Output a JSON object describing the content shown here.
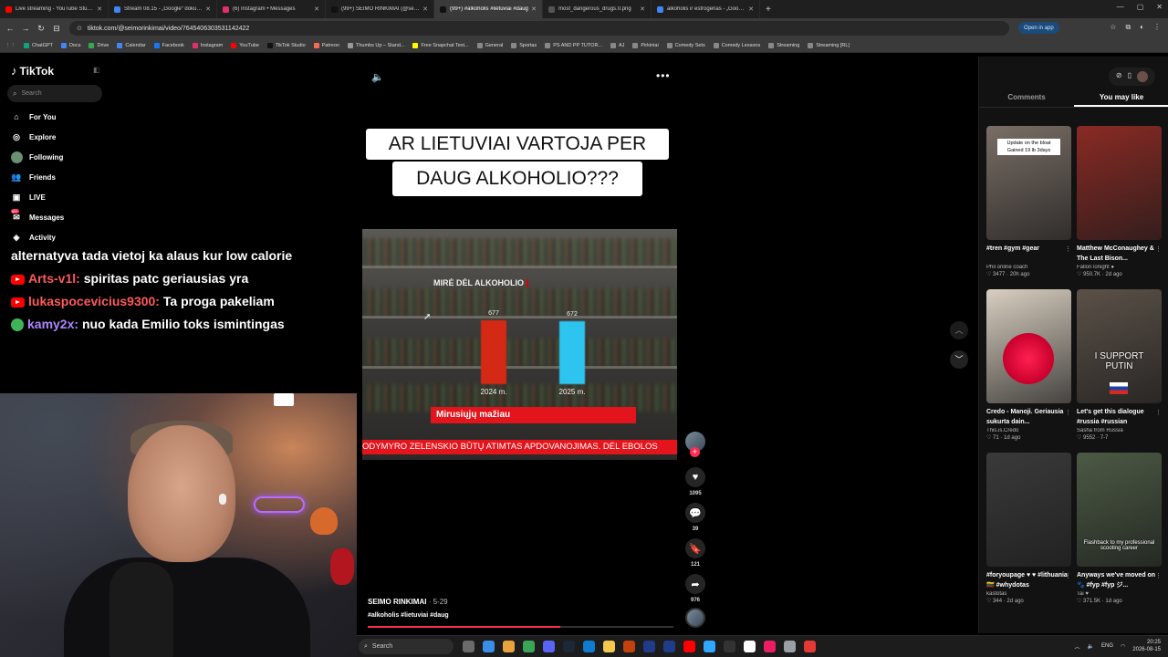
{
  "browser": {
    "tabs": [
      {
        "label": "Live streaming - YouTube Studio",
        "favicon_color": "#ff0000",
        "active": false
      },
      {
        "label": "Stream 08.15 - „Google“ dokumentai",
        "favicon_color": "#4285f4",
        "active": false
      },
      {
        "label": "(6) Instagram • Messages",
        "favicon_color": "#e1306c",
        "active": false
      },
      {
        "label": "(99+) SEIMO RINKIMAI (@seimorinkimai)",
        "favicon_color": "#111111",
        "active": false
      },
      {
        "label": "(99+) #alkoholis #lietuviai #daug",
        "favicon_color": "#111111",
        "active": true
      },
      {
        "label": "most_dangerous_drugs.0.png",
        "favicon_color": "#555555",
        "active": false
      },
      {
        "label": "alkoholis ir estrogenas - „Google“ paieška",
        "favicon_color": "#4285f4",
        "active": false
      }
    ],
    "url": "tiktok.com/@seimorinkimai/video/7645406303531142422",
    "open_app_label": "Open in app",
    "bookmarks": [
      {
        "label": "ChatGPT",
        "color": "#10a37f"
      },
      {
        "label": "Docs",
        "color": "#4285f4"
      },
      {
        "label": "Drive",
        "color": "#34a853"
      },
      {
        "label": "Calendar",
        "color": "#4285f4"
      },
      {
        "label": "Facebook",
        "color": "#1877f2"
      },
      {
        "label": "Instagram",
        "color": "#e1306c"
      },
      {
        "label": "YouTube",
        "color": "#ff0000"
      },
      {
        "label": "TikTok Studio",
        "color": "#111111"
      },
      {
        "label": "Patreon",
        "color": "#f96854"
      },
      {
        "label": "Thumbs Up – Stand...",
        "color": "#999999"
      },
      {
        "label": "Free Snapchat Text...",
        "color": "#fffc00"
      },
      {
        "label": "General",
        "color": "#888888"
      },
      {
        "label": "Sportas",
        "color": "#888888"
      },
      {
        "label": "PS AND PP TUTOR...",
        "color": "#888888"
      },
      {
        "label": "AJ",
        "color": "#888888"
      },
      {
        "label": "Pirkiniai",
        "color": "#888888"
      },
      {
        "label": "Comedy Sets",
        "color": "#888888"
      },
      {
        "label": "Comedy Lessons",
        "color": "#888888"
      },
      {
        "label": "Streaming",
        "color": "#888888"
      },
      {
        "label": "Streaming [RL]",
        "color": "#888888"
      }
    ]
  },
  "tiktok": {
    "logo": "TikTok",
    "search_placeholder": "Search",
    "nav": [
      {
        "label": "For You",
        "icon": "home-icon",
        "glyph": "⌂"
      },
      {
        "label": "Explore",
        "icon": "compass-icon",
        "glyph": "◎"
      },
      {
        "label": "Following",
        "icon": "following-avatar",
        "glyph": ""
      },
      {
        "label": "Friends",
        "icon": "friends-icon",
        "glyph": "👥"
      },
      {
        "label": "LIVE",
        "icon": "live-icon",
        "glyph": "▣"
      },
      {
        "label": "Messages",
        "icon": "messages-icon",
        "glyph": "✉"
      },
      {
        "label": "Activity",
        "icon": "activity-icon",
        "glyph": "◈"
      }
    ],
    "messages_badge": "99+"
  },
  "chat": [
    {
      "platform": "",
      "user": "",
      "text": "alternatyva tada vietoj ka alaus kur low calorie"
    },
    {
      "platform": "youtube",
      "user": "Arts-v1l:",
      "text": "spiritas patc geriausias yra"
    },
    {
      "platform": "youtube",
      "user": "lukaspocevicius9300:",
      "text": "Ta proga pakeliam"
    },
    {
      "platform": "twitch",
      "user": "kamy2x:",
      "text": "nuo kada Emilio toks ismintingas"
    }
  ],
  "video": {
    "caption_line1": "AR LIETUVIAI VARTOJA PER",
    "caption_line2": "DAUG ALKOHOLIO???",
    "author": "SEIMO RINKIMAI",
    "date": "· 5-29",
    "tags": "#alkoholis #lietuviai #daug",
    "progress_fraction": 0.63,
    "banner": "Mirusiųjų mažiau",
    "ticker": "ODYMYRO ZELENSKIO BŪTŲ ATIMTAS APDOVANOJIMAS.   DĖL EBOLOS",
    "chart_data": {
      "type": "bar",
      "title": "MIRĖ DĖL ALKOHOLIO",
      "categories": [
        "2024 m.",
        "2025 m."
      ],
      "values": [
        677,
        672
      ],
      "colors": [
        "#d42a15",
        "#2ec4f0"
      ],
      "xlabel": "",
      "ylabel": "",
      "grid": false
    },
    "actions": [
      {
        "icon": "heart-icon",
        "glyph": "♥",
        "count": "1095"
      },
      {
        "icon": "comment-icon",
        "glyph": "💬",
        "count": "39"
      },
      {
        "icon": "bookmark-icon",
        "glyph": "🔖",
        "count": "121"
      },
      {
        "icon": "share-icon",
        "glyph": "➦",
        "count": "976"
      }
    ]
  },
  "right_panel": {
    "tabs": [
      {
        "label": "Comments",
        "active": false
      },
      {
        "label": "You may like",
        "active": true
      }
    ],
    "cards": [
      {
        "title": "#tren #gym #gear",
        "author": "Phil online coach",
        "meta": "♡ 3477 · 20h ago",
        "overlay": "Update on the bloat Gained 19 lb 3days",
        "bg": "#7a6e66",
        "overlay_style": "box"
      },
      {
        "title": "Matthew McConaughey & The Last Bison...",
        "author": "FallonTonight ●",
        "meta": "♡ 950.7K · 2d ago",
        "overlay": "",
        "bg": "#8a2a24",
        "overlay_style": ""
      },
      {
        "title": "Credo - Manoji. Geriausia sukurta dain...",
        "author": "This.is.Credo",
        "meta": "♡ 71 · 1d ago",
        "overlay": "",
        "bg": "#d9cfc1",
        "overlay_style": ""
      },
      {
        "title": "Let's get this dialogue #russia #russian",
        "author": "Sasha from Russia",
        "meta": "♡ 9552 · 7-7",
        "overlay": "I SUPPORT PUTIN",
        "bg": "#5b5148",
        "overlay_style": "big"
      },
      {
        "title": "#foryoupage ♥ ♥ #lithuania 🇱🇹 #whydotas",
        "author": "kastotas",
        "meta": "♡ 344 · 2d ago",
        "overlay": "",
        "bg": "#3a3a3a",
        "overlay_style": ""
      },
      {
        "title": "Anyways we've moved on 🐾 #fyp #fyp ジ...",
        "author": "Tai ♥",
        "meta": "♡ 371.5K · 1d ago",
        "overlay": "Flashback to my professional scooting career",
        "bg": "#4c5a44",
        "overlay_style": "small"
      }
    ]
  },
  "taskbar": {
    "search_placeholder": "Search",
    "apps": [
      "#6b6b6b",
      "#3a8ee6",
      "#e8a33d",
      "#3aa655",
      "#5865f2",
      "#1b2838",
      "#0f7bd1",
      "#f2c94c",
      "#c2410c",
      "#1f3b8a",
      "#1f3b8a",
      "#ff0000",
      "#31a8ff",
      "#333333",
      "#ffffff",
      "#e91e63",
      "#9aa0a6",
      "#e53935"
    ],
    "language": "ENG",
    "time": "20:25",
    "date": "2026-08-15"
  }
}
